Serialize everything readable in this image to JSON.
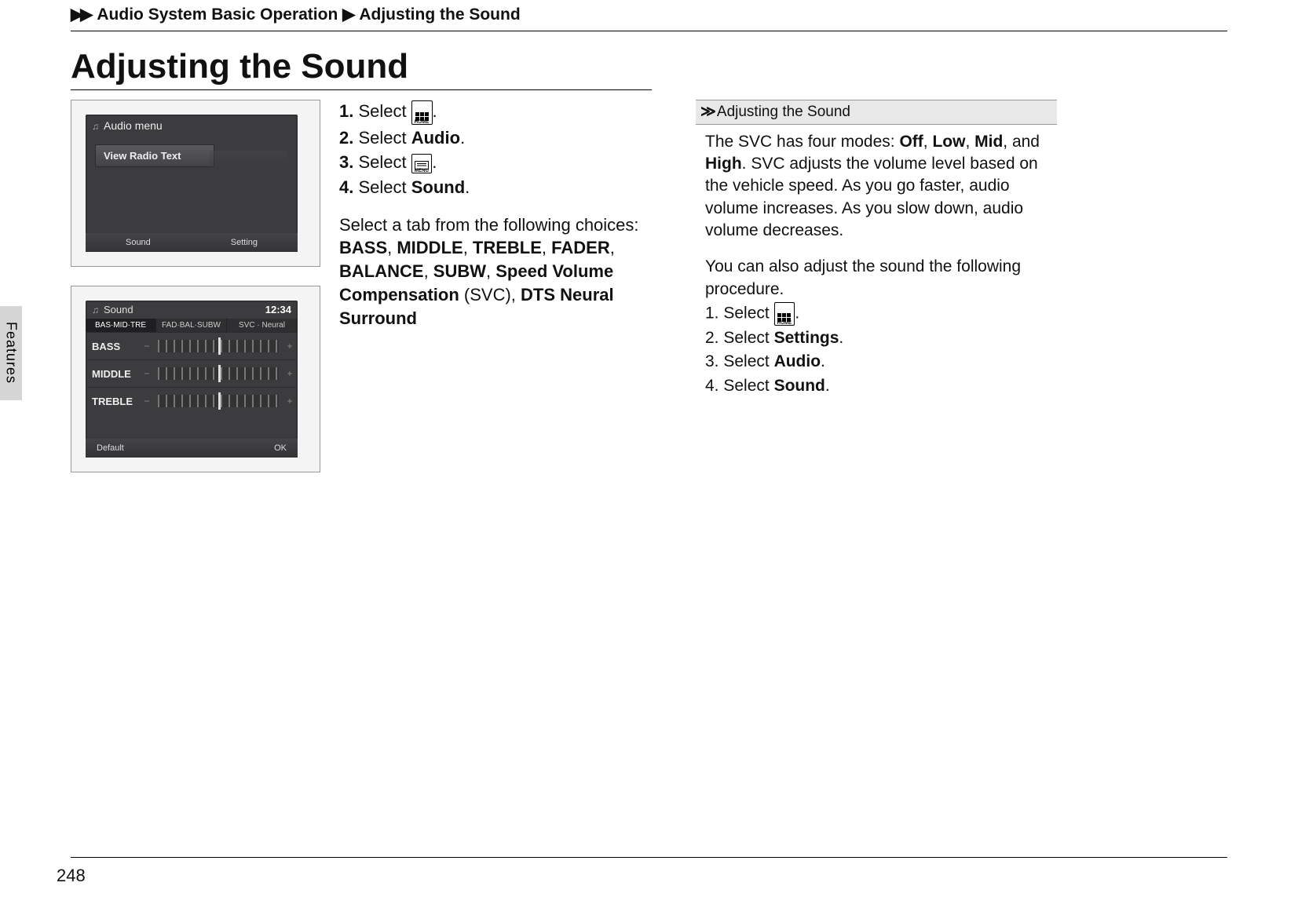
{
  "breadcrumb": {
    "arrows": "▶▶",
    "seg1": "Audio System Basic Operation",
    "sep": "▶",
    "seg2": "Adjusting the Sound"
  },
  "heading": "Adjusting the Sound",
  "features_tab": "Features",
  "page_number": "248",
  "screenshot1": {
    "title": "Audio menu",
    "item1": "View Radio Text",
    "bottom_left": "Sound",
    "bottom_right": "Setting"
  },
  "screenshot2": {
    "title": "Sound",
    "clock": "12:34",
    "tab1": "BAS·MID·TRE",
    "tab2": "FAD·BAL·SUBW",
    "tab3": "SVC · Neural",
    "rows": [
      {
        "label": "BASS",
        "minus": "−",
        "plus": "+"
      },
      {
        "label": "MIDDLE",
        "minus": "−",
        "plus": "+"
      },
      {
        "label": "TREBLE",
        "minus": "−",
        "plus": "+"
      }
    ],
    "bottom_left": "Default",
    "bottom_right": "OK"
  },
  "icons": {
    "home_label": "HOME",
    "menu_label": "MENU"
  },
  "steps_main": {
    "s1a": "1.",
    "s1b": " Select ",
    "s1c": ".",
    "s2a": "2.",
    "s2b": " Select ",
    "s2c": "Audio",
    "s2d": ".",
    "s3a": "3.",
    "s3b": " Select ",
    "s3c": ".",
    "s4a": "4.",
    "s4b": " Select ",
    "s4c": "Sound",
    "s4d": "."
  },
  "choices_intro": "Select a tab from the following choices:",
  "choices": {
    "p1": "BASS",
    "p2": "MIDDLE",
    "p3": "TREBLE",
    "p4": "FADER",
    "p5": "BALANCE",
    "p6": "SUBW",
    "p7": "Speed Volume Compensation",
    "p8": " (SVC), ",
    "p9": "DTS Neural Surround",
    "comma": ", "
  },
  "side": {
    "chev": "≫",
    "title": "Adjusting the Sound",
    "body1a": "The SVC has four modes: ",
    "off": "Off",
    "low": "Low",
    "mid": "Mid",
    "high": "High",
    "body1b": ". SVC adjusts the volume level based on the vehicle speed. As you go faster, audio volume increases. As you slow down, audio volume decreases.",
    "body2": "You can also adjust the sound the following procedure.",
    "s1a": "1.  Select ",
    "s1b": ".",
    "s2a": "2.  Select ",
    "s2b": "Settings",
    "s2c": ".",
    "s3a": "3.  Select ",
    "s3b": "Audio",
    "s3c": ".",
    "s4a": "4.  Select ",
    "s4b": "Sound",
    "s4c": "."
  }
}
